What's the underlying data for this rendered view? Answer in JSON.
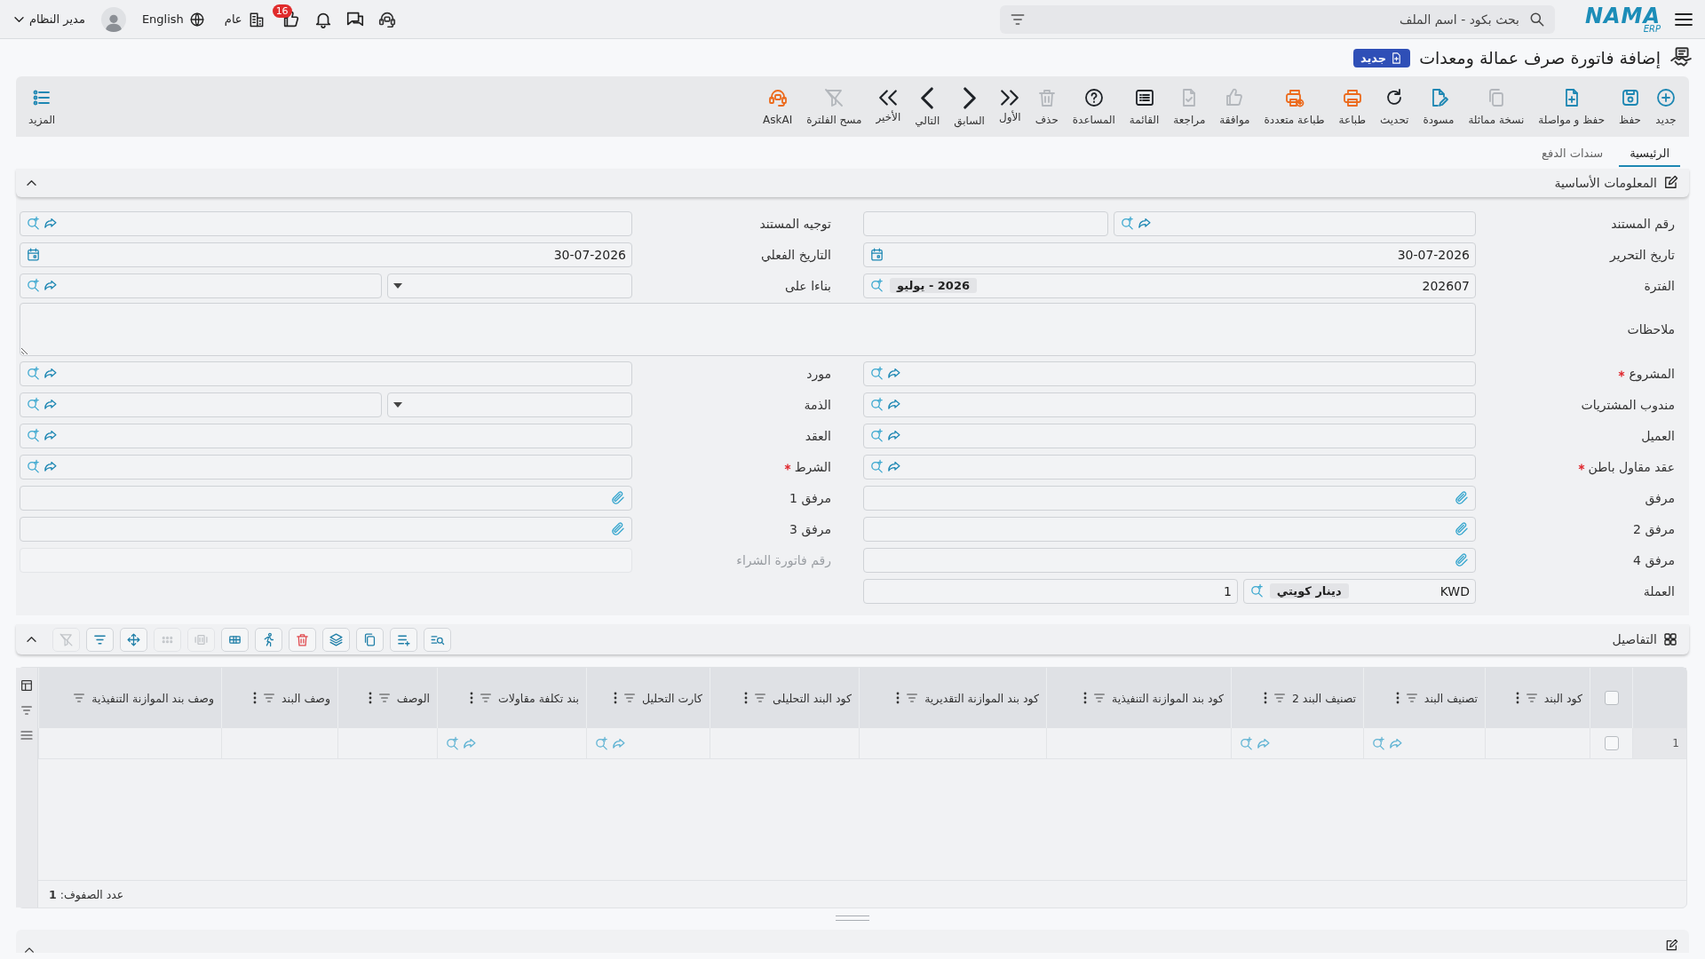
{
  "topbar": {
    "logo": {
      "name": "NAMA",
      "sub": "ERP"
    },
    "search": {
      "placeholder": "بحث بكود - اسم الملف"
    },
    "notifications_badge": "16",
    "company": "عام",
    "language": "English",
    "user": "مدير النظام"
  },
  "page": {
    "title": "إضافة فاتورة صرف عمالة ومعدات",
    "status": "جديد"
  },
  "toolbar": [
    {
      "label": "جديد",
      "color": "#1d87b3",
      "disabled": false
    },
    {
      "label": "حفظ",
      "color": "#1d87b3",
      "disabled": false
    },
    {
      "label": "حفظ و مواصلة",
      "color": "#1d87b3",
      "disabled": false
    },
    {
      "label": "نسخة مماثلة",
      "disabled": true
    },
    {
      "label": "مسودة",
      "color": "#1d87b3",
      "disabled": false
    },
    {
      "label": "تحديث",
      "color": "#1f2328",
      "disabled": false
    },
    {
      "label": "طباعة",
      "color": "#ec6a1c",
      "disabled": false
    },
    {
      "label": "طباعة متعددة",
      "color": "#ec6a1c",
      "disabled": false
    },
    {
      "label": "موافقة",
      "disabled": true
    },
    {
      "label": "مراجعة",
      "disabled": true
    },
    {
      "label": "القائمة",
      "color": "#1f2328",
      "disabled": false
    },
    {
      "label": "المساعدة",
      "color": "#1f2328",
      "disabled": false
    },
    {
      "label": "حذف",
      "disabled": true
    },
    {
      "label": "الأول",
      "color": "#1f2328",
      "disabled": false
    },
    {
      "label": "السابق",
      "color": "#1f2328",
      "disabled": false
    },
    {
      "label": "التالي",
      "color": "#1f2328",
      "disabled": false
    },
    {
      "label": "الأخير",
      "color": "#1f2328",
      "disabled": false
    },
    {
      "label": "مسح الفلترة",
      "disabled": true
    },
    {
      "label": "AskAI",
      "color": "#ec6a1c",
      "disabled": false
    }
  ],
  "more": {
    "label": "المزيد"
  },
  "tabs": [
    {
      "label": "الرئيسية",
      "selected": true
    },
    {
      "label": "سندات الدفع",
      "selected": false
    }
  ],
  "basic_info": {
    "title": "المعلومات الأساسية",
    "expanded": true,
    "rows": [
      {
        "fields": [
          {
            "label": "رقم المستند",
            "kind": "lookup_with_box",
            "required": false
          },
          {
            "label": "توجيه المستند",
            "kind": "lookup",
            "required": false
          }
        ]
      },
      {
        "fields": [
          {
            "label": "تاريخ التحرير",
            "kind": "date",
            "value": "30-07-2026",
            "required": false
          },
          {
            "label": "التاريخ الفعلي",
            "kind": "date",
            "value": "30-07-2026",
            "required": false
          }
        ]
      },
      {
        "fields": [
          {
            "label": "الفترة",
            "kind": "lookup_tag",
            "value": "202607",
            "tag": "2026 - يوليو",
            "required": false
          },
          {
            "label": "بناءا على",
            "kind": "dropdown_lookup",
            "required": false
          }
        ]
      },
      {
        "fields": [
          {
            "label": "ملاحظات",
            "kind": "textarea",
            "required": false
          }
        ]
      },
      {
        "fields": [
          {
            "label": "المشروع",
            "kind": "lookup",
            "required": true
          },
          {
            "label": "مورد",
            "kind": "lookup",
            "required": false
          }
        ]
      },
      {
        "fields": [
          {
            "label": "مندوب المشتريات",
            "kind": "lookup",
            "required": false
          },
          {
            "label": "الذمة",
            "kind": "dropdown_lookup",
            "required": false
          }
        ]
      },
      {
        "fields": [
          {
            "label": "العميل",
            "kind": "lookup",
            "required": false
          },
          {
            "label": "العقد",
            "kind": "lookup",
            "required": false
          }
        ]
      },
      {
        "fields": [
          {
            "label": "عقد مقاول باطن",
            "kind": "lookup",
            "required": true
          },
          {
            "label": "الشرط",
            "kind": "lookup",
            "required": true
          }
        ]
      },
      {
        "fields": [
          {
            "label": "مرفق",
            "kind": "attachment",
            "required": false
          },
          {
            "label": "مرفق 1",
            "kind": "attachment",
            "required": false
          }
        ]
      },
      {
        "fields": [
          {
            "label": "مرفق 2",
            "kind": "attachment",
            "required": false
          },
          {
            "label": "مرفق 3",
            "kind": "attachment",
            "required": false
          }
        ]
      },
      {
        "fields": [
          {
            "label": "مرفق 4",
            "kind": "attachment",
            "required": false
          },
          {
            "label": "رقم فاتورة الشراء",
            "kind": "readonly",
            "required": false
          }
        ]
      },
      {
        "fields": [
          {
            "label": "العملة",
            "kind": "lookup_tag",
            "value": "KWD",
            "tag": "دينار كويتي",
            "rate": "1",
            "required": false
          }
        ]
      }
    ]
  },
  "details": {
    "title": "التفاصيل",
    "expanded": true,
    "tools": [
      {
        "disabled": false
      },
      {
        "disabled": false
      },
      {
        "disabled": false
      },
      {
        "disabled": false
      },
      {
        "disabled": false
      },
      {
        "disabled": false
      },
      {
        "disabled": false
      },
      {
        "disabled": true
      },
      {
        "disabled": true
      },
      {
        "disabled": false
      },
      {
        "disabled": false
      },
      {
        "disabled": true
      }
    ],
    "header_checked": false,
    "columns": [
      {
        "label": "كود البند",
        "menu": true
      },
      {
        "label": "تصنيف البند",
        "menu": true
      },
      {
        "label": "تصنيف البند 2",
        "menu": true
      },
      {
        "label": "كود بند الموازنة التنفيذية",
        "menu": true
      },
      {
        "label": "كود بند الموازنة التقديرية",
        "menu": true
      },
      {
        "label": "كود البند التحليلى",
        "menu": true
      },
      {
        "label": "كارت التحليل",
        "menu": true
      },
      {
        "label": "بند تكلفة مقاولات",
        "menu": true
      },
      {
        "label": "الوصف",
        "menu": true
      },
      {
        "label": "وصف البند",
        "menu": true
      },
      {
        "label": "وصف بند الموازنة التنفيذية",
        "menu": false
      }
    ],
    "rows": [
      {
        "number": "1",
        "checked": false,
        "cells": [
          {
            "kind": "plain"
          },
          {
            "kind": "lookup"
          },
          {
            "kind": "lookup"
          },
          {
            "kind": "plain"
          },
          {
            "kind": "plain"
          },
          {
            "kind": "plain"
          },
          {
            "kind": "lookup"
          },
          {
            "kind": "lookup"
          },
          {
            "kind": "plain"
          },
          {
            "kind": "plain"
          },
          {
            "kind": "plain"
          }
        ]
      }
    ],
    "row_count": "عدد الصفوف: **1**"
  }
}
